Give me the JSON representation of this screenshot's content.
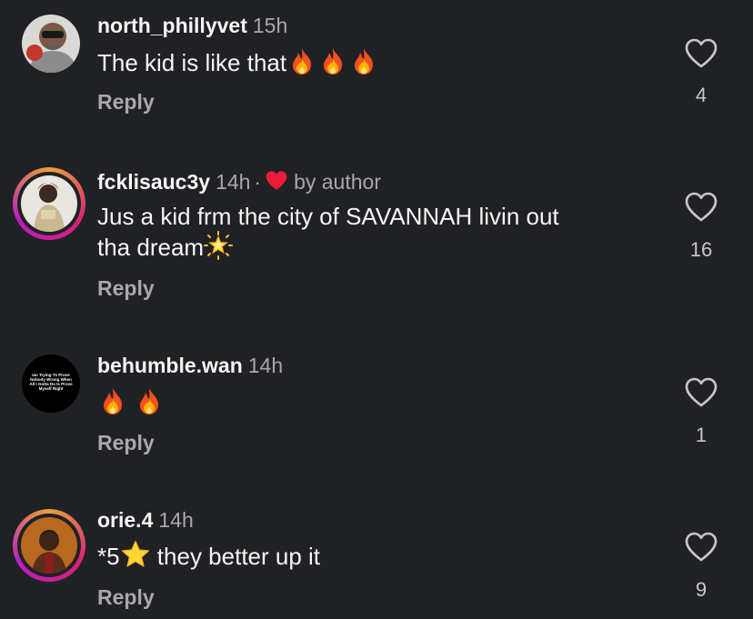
{
  "comments": [
    {
      "username": "north_phillyvet",
      "time": "15h",
      "text": "The kid is like that",
      "emojis": [
        "fire-emoji",
        "fire-emoji",
        "fire-emoji"
      ],
      "reply_label": "Reply",
      "likes": "4"
    },
    {
      "username": "fcklisauc3y",
      "time": "14h",
      "separator": "·",
      "by_author": "by author",
      "text_line1": "Jus a kid frm the city of SAVANNAH livin out",
      "text_line2": "tha dream",
      "emojis": [
        "glowing-star-emoji"
      ],
      "reply_label": "Reply",
      "likes": "16"
    },
    {
      "username": "behumble.wan",
      "time": "14h",
      "avatar_text": "Ian Trying To Prove Nobody Wrong When All I Gotta Do Is Prove Myself Right",
      "emojis": [
        "fire-emoji",
        "fire-emoji"
      ],
      "reply_label": "Reply",
      "likes": "1"
    },
    {
      "username": "orie.4",
      "time": "14h",
      "text_prefix": "*5",
      "text": " they better up it",
      "emojis": [
        "star-emoji"
      ],
      "reply_label": "Reply",
      "likes": "9"
    }
  ],
  "colors": {
    "background": "#202124",
    "primary_text": "#f5f5f5",
    "secondary_text": "#a8a8ad",
    "author_heart": "#ed1c3a",
    "story_ring": [
      "#e8a13a",
      "#d8207a",
      "#b71fbf"
    ]
  },
  "icons": {
    "like": "heart-outline-icon",
    "author_like": "heart-filled-icon"
  }
}
